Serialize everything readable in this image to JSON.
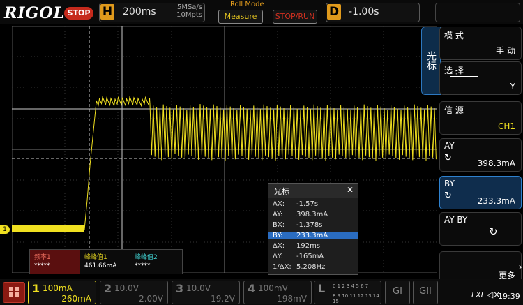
{
  "topbar": {
    "logo": "RIGOL",
    "status": "STOP",
    "horizontal_label": "H",
    "timebase": "200ms",
    "sample_rate": "5MSa/s",
    "memory_depth": "10Mpts",
    "roll_mode": "Roll Mode",
    "measure_label": "Measure",
    "stoprun_label": "STOP/RUN",
    "delay_label": "D",
    "delay_value": "-1.00s"
  },
  "right_menu": {
    "tab_label": "光标",
    "items": [
      {
        "label": "模 式",
        "value": "手 动"
      },
      {
        "label": "选 择",
        "value": "Y"
      },
      {
        "label": "信 源",
        "value": "CH1"
      },
      {
        "label": "AY",
        "value": "398.3mA"
      },
      {
        "label": "BY",
        "value": "233.3mA"
      },
      {
        "label": "AY BY",
        "value": ""
      },
      {
        "label": "",
        "value": "更多"
      }
    ]
  },
  "cursor_popup": {
    "title": "光标",
    "close": "✕",
    "rows": [
      {
        "k": "AX:",
        "v": "-1.57s"
      },
      {
        "k": "AY:",
        "v": "398.3mA"
      },
      {
        "k": "BX:",
        "v": "-1.378s"
      },
      {
        "k": "BY:",
        "v": "233.3mA"
      },
      {
        "k": "ΔX:",
        "v": "192ms"
      },
      {
        "k": "ΔY:",
        "v": "-165mA"
      },
      {
        "k": "1/ΔX:",
        "v": "5.208Hz"
      }
    ]
  },
  "measurements": [
    {
      "header": "频率1",
      "value": "*****"
    },
    {
      "header": "峰峰值1",
      "value": "461.66mA"
    },
    {
      "header": "峰峰值2",
      "value": "*****"
    }
  ],
  "channels": [
    {
      "num": "1",
      "scale": "100mA",
      "offset": "-260mA",
      "color": "#f0e020"
    },
    {
      "num": "2",
      "scale": "10.0V",
      "offset": "-2.00V",
      "color": "#777777"
    },
    {
      "num": "3",
      "scale": "10.0V",
      "offset": "-19.2V",
      "color": "#777777"
    },
    {
      "num": "4",
      "scale": "100mV",
      "offset": "-198mV",
      "color": "#777777"
    }
  ],
  "logic": {
    "label": "L",
    "bits_top": "0 1 2 3 4 5 6 7",
    "bits_bottom": "8 9 10 11 12 13 14 15"
  },
  "gi": [
    "GI",
    "GII"
  ],
  "clock": "19:39",
  "channel1_marker": "1"
}
